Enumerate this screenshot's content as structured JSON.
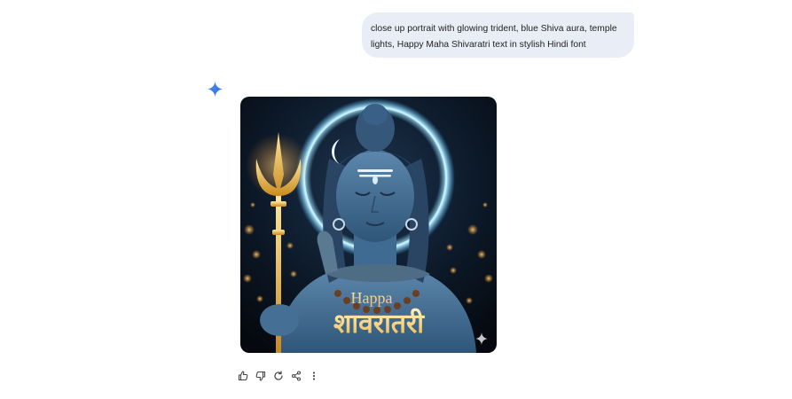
{
  "user_message": {
    "text": "close up portrait with glowing trident, blue Shiva aura, temple lights, Happy Maha Shivaratri text in stylish Hindi font"
  },
  "response": {
    "assistant_icon": "sparkle-icon",
    "image": {
      "overlay_text_top": "Happa",
      "overlay_text_hindi": "शावरातरी",
      "alt": "Generated image"
    }
  },
  "actions": [
    {
      "icon": "thumbs-up-icon"
    },
    {
      "icon": "thumbs-down-icon"
    },
    {
      "icon": "regenerate-icon"
    },
    {
      "icon": "share-icon"
    },
    {
      "icon": "more-vert-icon"
    }
  ],
  "colors": {
    "bubble_bg": "#e9eef6",
    "accent_blue": "#4285f4",
    "icon_gray": "#444746"
  }
}
